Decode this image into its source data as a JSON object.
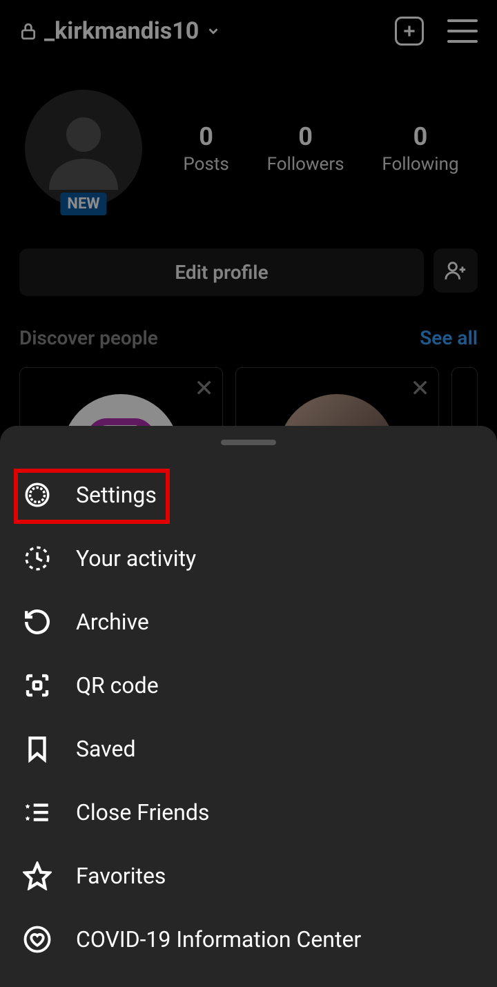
{
  "header": {
    "username": "_kirkmandis10"
  },
  "profile": {
    "new_badge": "NEW",
    "stats": {
      "posts": {
        "value": "0",
        "label": "Posts"
      },
      "followers": {
        "value": "0",
        "label": "Followers"
      },
      "following": {
        "value": "0",
        "label": "Following"
      }
    }
  },
  "actions": {
    "edit_profile": "Edit profile"
  },
  "discover": {
    "title": "Discover people",
    "see_all": "See all"
  },
  "menu": {
    "settings": "Settings",
    "activity": "Your activity",
    "archive": "Archive",
    "qr": "QR code",
    "saved": "Saved",
    "close_friends": "Close Friends",
    "favorites": "Favorites",
    "covid": "COVID-19 Information Center"
  }
}
